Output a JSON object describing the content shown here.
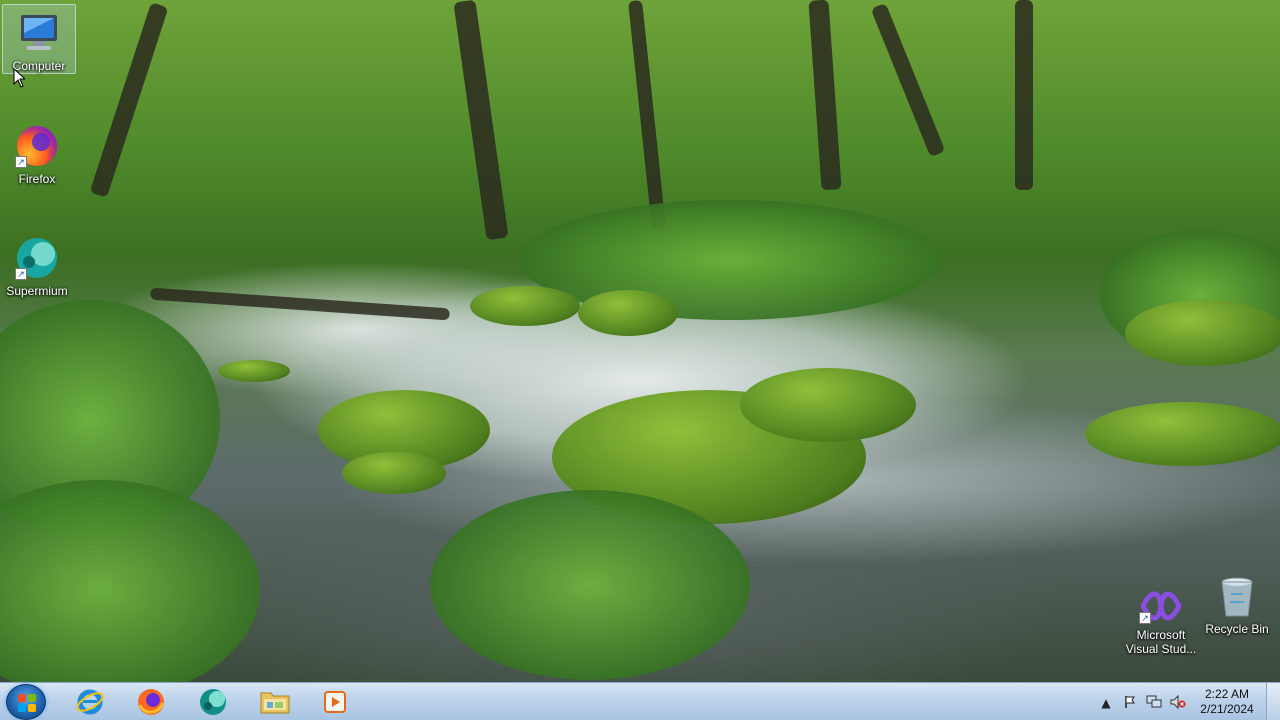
{
  "desktop": {
    "icons": [
      {
        "label": "Computer"
      },
      {
        "label": "Firefox"
      },
      {
        "label": "Supermium"
      },
      {
        "label": "Microsoft Visual Stud..."
      },
      {
        "label": "Recycle Bin"
      }
    ]
  },
  "taskbar": {
    "pinned": [
      "start-orb",
      "internet-explorer-icon",
      "firefox-icon",
      "supermium-icon",
      "file-explorer-icon",
      "media-player-icon"
    ],
    "tray": {
      "overflow_glyph": "▲",
      "icons": [
        "action-center-flag-icon",
        "network-icon",
        "volume-muted-icon"
      ]
    },
    "clock": {
      "time": "2:22 AM",
      "date": "2/21/2024"
    }
  },
  "colors": {
    "taskbar": "#bcd2ea",
    "accent": "#1d5fa8"
  }
}
